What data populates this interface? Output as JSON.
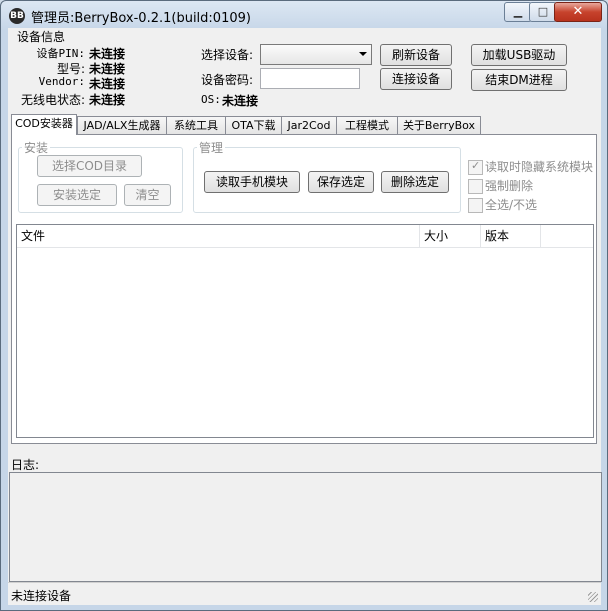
{
  "window": {
    "title": "管理员:BerryBox-0.2.1(build:0109)",
    "app_icon": "blackberry-icon"
  },
  "device_info": {
    "group_label": "设备信息",
    "pin_label": "设备PIN:",
    "pin_value": "未连接",
    "model_label": "型号:",
    "model_value": "未连接",
    "vendor_label": "Vendor:",
    "vendor_value": "未连接",
    "radio_label": "无线电状态:",
    "radio_value": "未连接",
    "select_device_label": "选择设备:",
    "select_device_value": "",
    "password_label": "设备密码:",
    "password_value": "",
    "os_label": "OS:",
    "os_value": "未连接"
  },
  "actions": {
    "refresh": "刷新设备",
    "connect": "连接设备",
    "load_usb": "加载USB驱动",
    "end_dm": "结束DM进程"
  },
  "tabs": [
    {
      "label": "COD安装器"
    },
    {
      "label": "JAD/ALX生成器"
    },
    {
      "label": "系统工具"
    },
    {
      "label": "OTA下载"
    },
    {
      "label": "Jar2Cod"
    },
    {
      "label": "工程模式"
    },
    {
      "label": "关于BerryBox"
    }
  ],
  "install": {
    "group_label": "安装",
    "choose_dir": "选择COD目录",
    "install_selected": "安装选定",
    "clear": "清空"
  },
  "manage": {
    "group_label": "管理",
    "read_modules": "读取手机模块",
    "save_selected": "保存选定",
    "delete_selected": "删除选定"
  },
  "options": {
    "hide_system": "读取时隐藏系统模块",
    "force_delete": "强制删除",
    "select_all": "全选/不选"
  },
  "file_table": {
    "columns": [
      "文件",
      "大小",
      "版本"
    ],
    "rows": []
  },
  "log": {
    "label": "日志:"
  },
  "status": {
    "text": "未连接设备"
  }
}
